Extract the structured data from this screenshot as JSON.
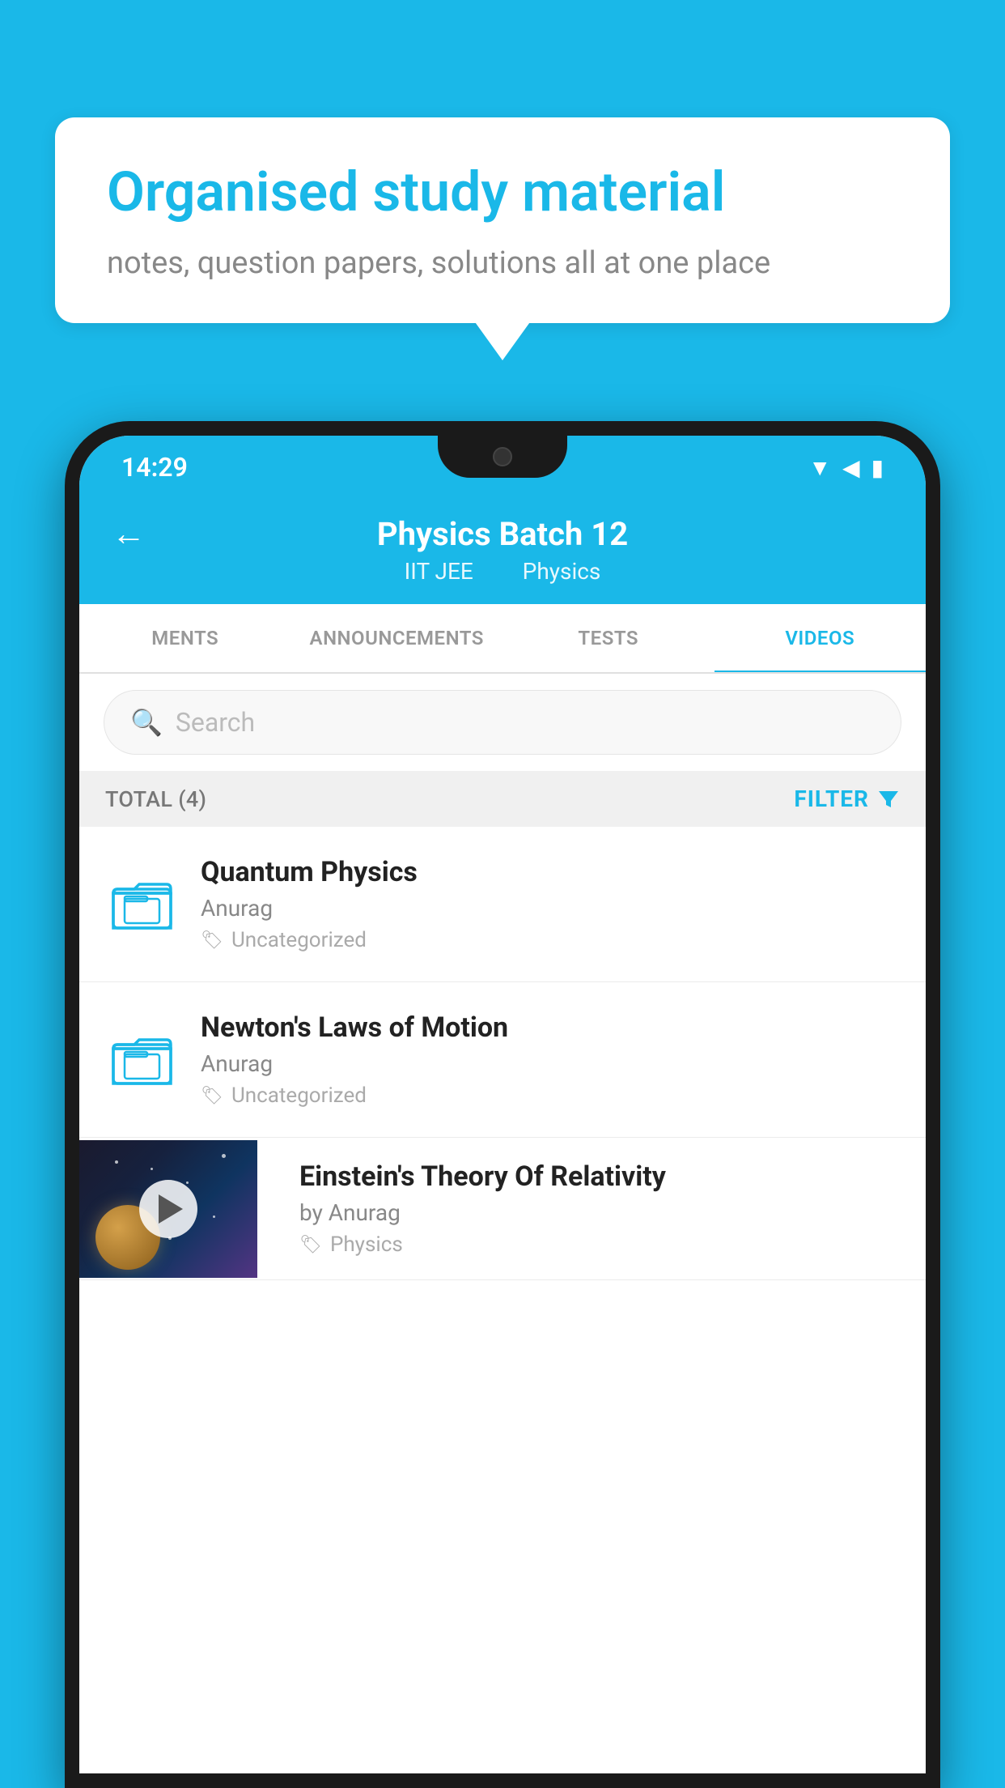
{
  "background_color": "#1ab8e8",
  "speech_bubble": {
    "heading": "Organised study material",
    "subtext": "notes, question papers, solutions all at one place"
  },
  "status_bar": {
    "time": "14:29",
    "icons": [
      "wifi",
      "signal",
      "battery"
    ]
  },
  "app_header": {
    "back_label": "←",
    "title": "Physics Batch 12",
    "subtitle_part1": "IIT JEE",
    "subtitle_part2": "Physics"
  },
  "tabs": [
    {
      "label": "MENTS",
      "active": false
    },
    {
      "label": "ANNOUNCEMENTS",
      "active": false
    },
    {
      "label": "TESTS",
      "active": false
    },
    {
      "label": "VIDEOS",
      "active": true
    }
  ],
  "search": {
    "placeholder": "Search"
  },
  "filter_bar": {
    "total_label": "TOTAL (4)",
    "filter_label": "FILTER"
  },
  "videos": [
    {
      "id": 1,
      "title": "Quantum Physics",
      "author": "Anurag",
      "tag": "Uncategorized",
      "has_thumbnail": false
    },
    {
      "id": 2,
      "title": "Newton's Laws of Motion",
      "author": "Anurag",
      "tag": "Uncategorized",
      "has_thumbnail": false
    },
    {
      "id": 3,
      "title": "Einstein's Theory Of Relativity",
      "author": "by Anurag",
      "tag": "Physics",
      "has_thumbnail": true
    }
  ]
}
